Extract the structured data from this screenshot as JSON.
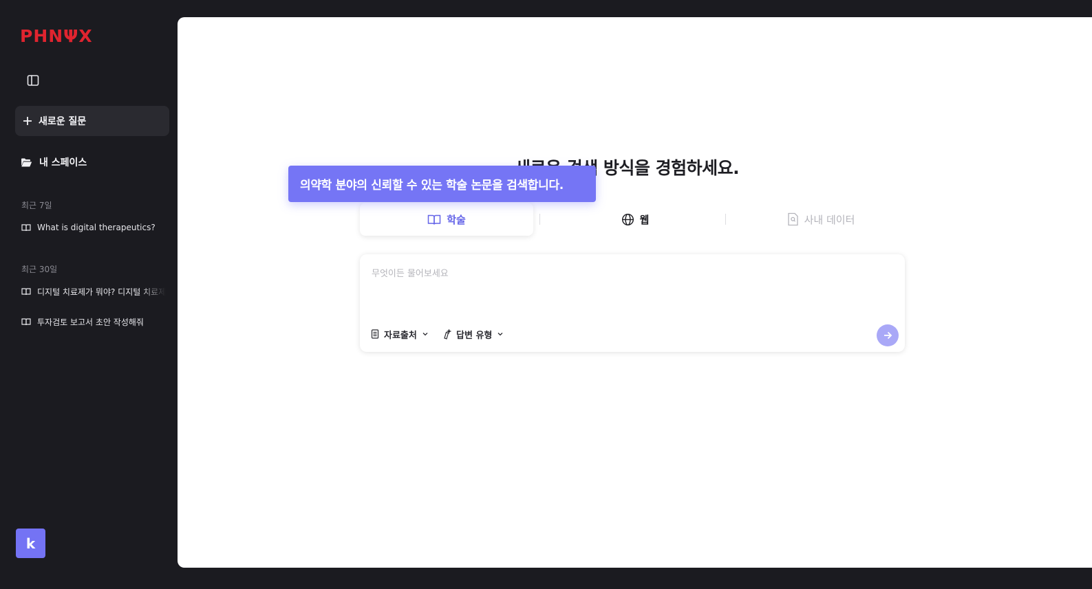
{
  "sidebar": {
    "logo": "PHNΨX",
    "new_question": "새로운 질문",
    "my_space": "내 스페이스",
    "recent_7": "최근 7일",
    "recent_7_items": [
      "What is digital therapeutics?"
    ],
    "recent_30": "최근 30일",
    "recent_30_items": [
      "디지털 치료제가 뭐야? 디지털 치료제",
      "투자검토 보고서 초안 작성해줘"
    ],
    "avatar_letter": "k"
  },
  "main": {
    "headline": "새로운 검색 방식을 경험하세요.",
    "tooltip": "의약학 분야의 신뢰할 수 있는 학술 논문을 검색합니다.",
    "tabs": [
      {
        "label": "학술",
        "icon": "book-open-icon",
        "active": true
      },
      {
        "label": "웹",
        "icon": "globe-icon",
        "active": false
      },
      {
        "label": "사내 데이터",
        "icon": "file-search-icon",
        "active": false
      }
    ],
    "query": {
      "placeholder": "무엇이든 물어보세요",
      "value": "",
      "source_label": "자료출처",
      "answer_type_label": "답변 유형"
    }
  },
  "colors": {
    "accent": "#7575f5",
    "logo_red": "#e0242f",
    "sidebar_bg": "#1b1b20",
    "send_button": "#a9a8f7"
  }
}
